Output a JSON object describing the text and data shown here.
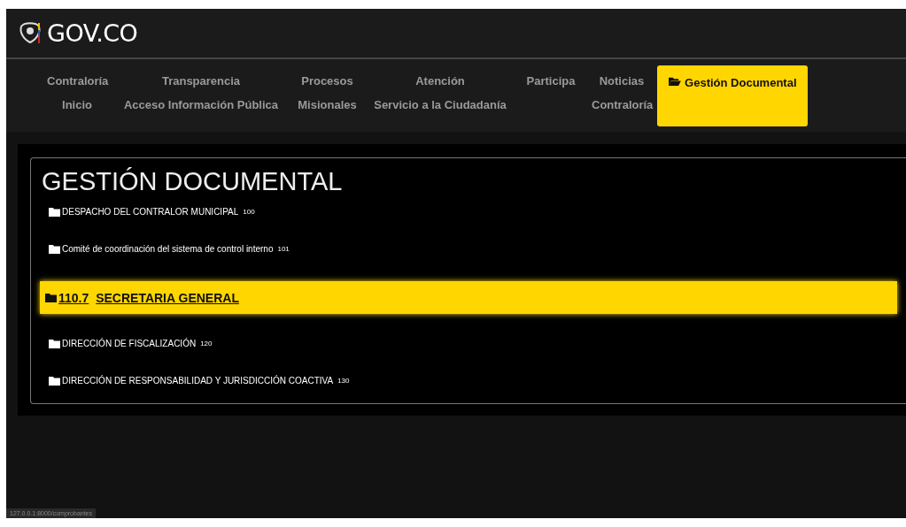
{
  "header": {
    "logo_text": "GOV.CO"
  },
  "nav": [
    {
      "lines": [
        "Contraloría",
        "Inicio"
      ],
      "selected": false
    },
    {
      "lines": [
        "Transparencia",
        "Acceso Información Pública"
      ],
      "selected": false
    },
    {
      "lines": [
        "Procesos",
        "Misionales"
      ],
      "selected": false
    },
    {
      "lines": [
        "Atención",
        "Servicio a la Ciudadanía"
      ],
      "selected": false
    },
    {
      "lines": [
        "Participa"
      ],
      "selected": false
    },
    {
      "lines": [
        "Noticias",
        "Contraloría"
      ],
      "selected": false
    },
    {
      "lines": [
        "Gestión Documental"
      ],
      "selected": true
    }
  ],
  "panel": {
    "title": "GESTIÓN DOCUMENTAL",
    "items": [
      {
        "name": "DESPACHO DEL CONTRALOR MUNICIPAL",
        "code": "100",
        "selected": false
      },
      {
        "name": "Comité de coordinación del sistema de control interno",
        "code": "101",
        "selected": false
      },
      {
        "name": "SECRETARIA GENERAL",
        "code": "110.7",
        "selected": true
      },
      {
        "name": "DIRECCIÓN DE FISCALIZACIÓN",
        "code": "120",
        "selected": false
      },
      {
        "name": "DIRECCIÓN DE RESPONSABILIDAD Y JURISDICCIÓN COACTIVA",
        "code": "130",
        "selected": false
      }
    ]
  },
  "status_bar": {
    "url": "127.0.0.1:8000/comprobantes"
  }
}
